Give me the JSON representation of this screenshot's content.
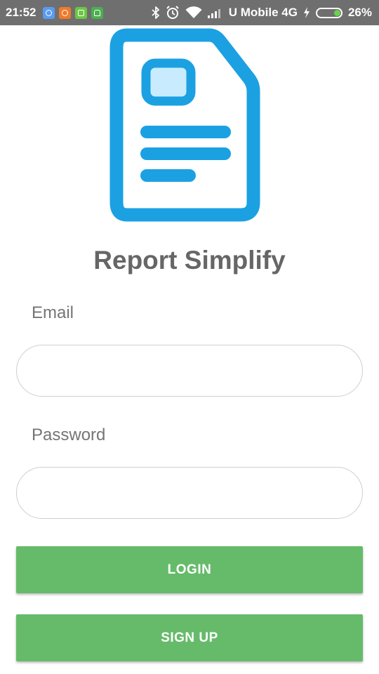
{
  "status_bar": {
    "time": "21:52",
    "carrier": "U Mobile 4G",
    "battery_percent": "26%",
    "battery_level": 0.26,
    "notification_icons": [
      {
        "name": "browser-notification-icon",
        "color": "#5b9bf0"
      },
      {
        "name": "game-notification-icon",
        "color": "#f07a2a"
      },
      {
        "name": "app-notification-icon",
        "color": "#6cc644"
      },
      {
        "name": "android-notification-icon",
        "color": "#4caf50"
      }
    ],
    "system_icons": [
      "bluetooth-icon",
      "alarm-icon",
      "wifi-icon",
      "signal-icon",
      "charging-icon",
      "battery-icon"
    ]
  },
  "logo": {
    "icon": "document-icon",
    "outline_color": "#1ba1e2",
    "accent_color": "#c8ecfd"
  },
  "app": {
    "title": "Report Simplify"
  },
  "form": {
    "email_label": "Email",
    "email_value": "",
    "email_placeholder": "",
    "password_label": "Password",
    "password_value": "",
    "password_placeholder": ""
  },
  "buttons": {
    "login": "LOGIN",
    "signup": "SIGN UP",
    "color": "#66bb6a"
  }
}
